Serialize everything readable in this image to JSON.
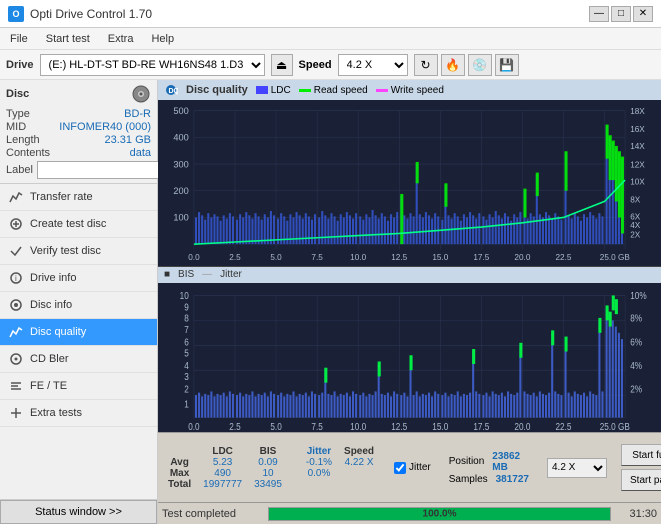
{
  "titleBar": {
    "title": "Opti Drive Control 1.70",
    "minimizeBtn": "—",
    "maximizeBtn": "□",
    "closeBtn": "✕"
  },
  "menuBar": {
    "items": [
      "File",
      "Start test",
      "Extra",
      "Help"
    ]
  },
  "driveBar": {
    "label": "Drive",
    "driveValue": "(E:) HL-DT-ST BD-RE  WH16NS48 1.D3",
    "speedLabel": "Speed",
    "speedValue": "4.2 X"
  },
  "discPanel": {
    "title": "Disc",
    "typeLabel": "Type",
    "typeValue": "BD-R",
    "midLabel": "MID",
    "midValue": "INFOMER40 (000)",
    "lengthLabel": "Length",
    "lengthValue": "23.31 GB",
    "contentsLabel": "Contents",
    "contentsValue": "data",
    "labelLabel": "Label",
    "labelValue": ""
  },
  "navItems": [
    {
      "id": "transfer-rate",
      "label": "Transfer rate",
      "icon": "chart"
    },
    {
      "id": "create-test-disc",
      "label": "Create test disc",
      "icon": "disc"
    },
    {
      "id": "verify-test-disc",
      "label": "Verify test disc",
      "icon": "check"
    },
    {
      "id": "drive-info",
      "label": "Drive info",
      "icon": "info"
    },
    {
      "id": "disc-info",
      "label": "Disc info",
      "icon": "disc-info"
    },
    {
      "id": "disc-quality",
      "label": "Disc quality",
      "icon": "quality",
      "active": true
    },
    {
      "id": "cd-bler",
      "label": "CD Bler",
      "icon": "cd"
    },
    {
      "id": "fe-te",
      "label": "FE / TE",
      "icon": "fe"
    },
    {
      "id": "extra-tests",
      "label": "Extra tests",
      "icon": "extra"
    }
  ],
  "chartTitle": "Disc quality",
  "legend": {
    "ldc": {
      "label": "LDC",
      "color": "#4444ff"
    },
    "readSpeed": {
      "label": "Read speed",
      "color": "#00ff00"
    },
    "writeSpeed": {
      "label": "Write speed",
      "color": "#ff00ff"
    },
    "bis": {
      "label": "BIS",
      "color": "#6688ff"
    },
    "jitter": {
      "label": "Jitter",
      "color": "#ffff00"
    }
  },
  "upperChart": {
    "yAxisMax": 500,
    "yAxisRight": [
      "18X",
      "16X",
      "14X",
      "12X",
      "10X",
      "8X",
      "6X",
      "4X",
      "2X"
    ],
    "xAxisValues": [
      "0.0",
      "2.5",
      "5.0",
      "7.5",
      "10.0",
      "12.5",
      "15.0",
      "17.5",
      "20.0",
      "22.5",
      "25.0 GB"
    ],
    "yAxisLeft": [
      "500",
      "400",
      "300",
      "200",
      "100"
    ]
  },
  "lowerChart": {
    "yAxisMax": 10,
    "yAxisRight": [
      "10%",
      "8%",
      "6%",
      "4%",
      "2%"
    ],
    "xAxisValues": [
      "0.0",
      "2.5",
      "5.0",
      "7.5",
      "10.0",
      "12.5",
      "15.0",
      "17.5",
      "20.0",
      "22.5",
      "25.0 GB"
    ],
    "yAxisLeft": [
      "10",
      "9",
      "8",
      "7",
      "6",
      "5",
      "4",
      "3",
      "2",
      "1"
    ]
  },
  "stats": {
    "headers": [
      "LDC",
      "BIS",
      "",
      "Jitter",
      "Speed"
    ],
    "avgLabel": "Avg",
    "avgLdc": "5.23",
    "avgBis": "0.09",
    "avgJitter": "-0.1%",
    "avgSpeed": "4.22 X",
    "maxLabel": "Max",
    "maxLdc": "490",
    "maxBis": "10",
    "maxJitter": "0.0%",
    "totalLabel": "Total",
    "totalLdc": "1997777",
    "totalBis": "33495",
    "positionLabel": "Position",
    "positionValue": "23862 MB",
    "samplesLabel": "Samples",
    "samplesValue": "381727",
    "speedSelectValue": "4.2 X",
    "startFullBtn": "Start full",
    "startPartBtn": "Start part"
  },
  "bottomBar": {
    "statusText": "Test completed",
    "progressPercent": 100,
    "progressLabel": "100.0%",
    "timeValue": "31:30"
  }
}
